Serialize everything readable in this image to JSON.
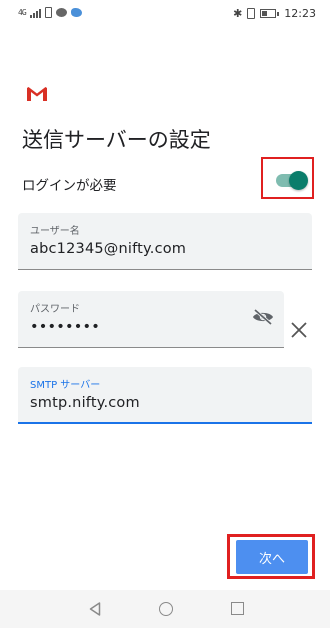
{
  "status_bar": {
    "network": "4G",
    "time": "12:23"
  },
  "screen": {
    "title": "送信サーバーの設定",
    "login_required_label": "ログインが必要",
    "login_required": true
  },
  "fields": {
    "username": {
      "label": "ユーザー名",
      "value": "abc12345@nifty.com"
    },
    "password": {
      "label": "パスワード",
      "value": "••••••••"
    },
    "smtp": {
      "label": "SMTP サーバー",
      "value": "smtp.nifty.com"
    }
  },
  "actions": {
    "next_label": "次へ"
  },
  "colors": {
    "accent": "#1a73e8",
    "toggle_on": "#0b7d6b",
    "button": "#4d8ff0",
    "highlight_box": "#e02020"
  }
}
